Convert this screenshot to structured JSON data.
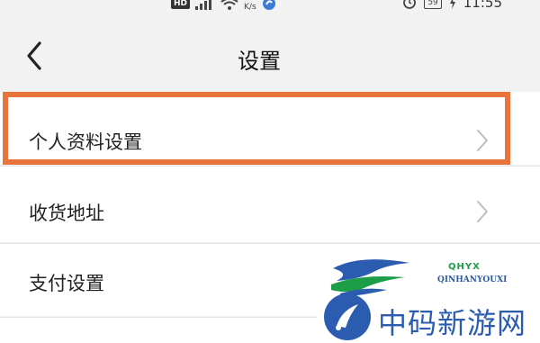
{
  "status_bar": {
    "hd_badge": "HD",
    "network_speed_unit": "K/s",
    "battery": "59",
    "time": "11:55",
    "icons": [
      "signal-icon",
      "wifi-icon",
      "app-notification-icon",
      "alarm-icon",
      "battery-icon",
      "charging-icon"
    ]
  },
  "nav": {
    "title": "设置",
    "back_icon": "chevron-left-icon"
  },
  "settings": {
    "items": [
      {
        "label": "个人资料设置",
        "highlighted": true
      },
      {
        "label": "收货地址",
        "highlighted": false
      },
      {
        "label": "支付设置",
        "highlighted": false
      }
    ]
  },
  "watermark": {
    "brand_code": "QHYX",
    "brand_pinyin": "QINHANYOUXI",
    "site_name": "中码新游网"
  },
  "colors": {
    "background": "#f2f2f2",
    "row_background": "#ffffff",
    "highlight_border": "#e8743b",
    "watermark_blue": "#2c5cb0",
    "watermark_green": "#1c9e48"
  }
}
